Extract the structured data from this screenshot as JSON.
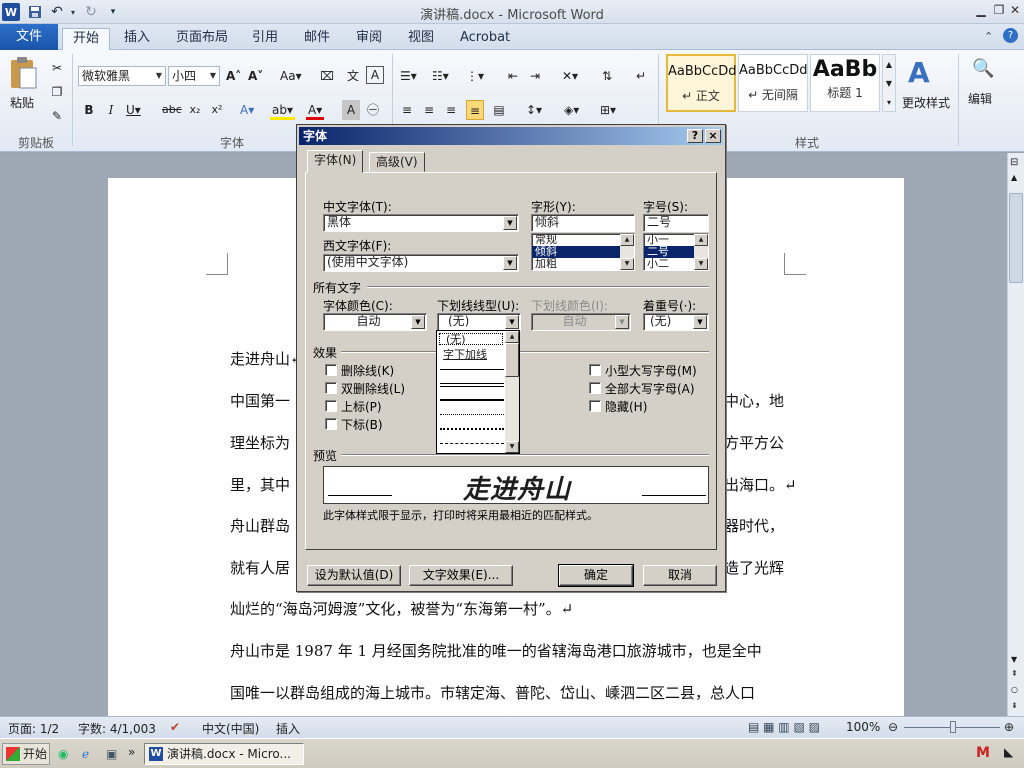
{
  "window": {
    "title": "演讲稿.docx - Microsoft Word",
    "undo_icon": "undo-icon",
    "redo_icon": "redo-icon"
  },
  "tabs": [
    "文件",
    "开始",
    "插入",
    "页面布局",
    "引用",
    "邮件",
    "审阅",
    "视图",
    "Acrobat"
  ],
  "ribbon": {
    "clipboard": {
      "paste": "粘贴",
      "group": "剪贴板"
    },
    "font": {
      "name": "微软雅黑",
      "size": "小四",
      "group": "字体"
    },
    "paragraph": {
      "group": "段落"
    },
    "styles": {
      "group": "样式",
      "items": [
        {
          "preview": "AaBbCcDd",
          "name": "↵ 正文"
        },
        {
          "preview": "AaBbCcDd",
          "name": "↵ 无间隔"
        },
        {
          "preview": "AaBb",
          "name": "标题 1"
        }
      ],
      "change": "更改样式"
    },
    "editing": {
      "label": "编辑"
    }
  },
  "document": {
    "lines": [
      "走进舟山↵",
      "中国第一",
      "理坐标为",
      "里，其中",
      "舟山群岛",
      "就有人居",
      "灿烂的“海岛河姆渡”文化，被誉为“东海第一村”。↵",
      "舟山市是 1987 年 1 月经国务院批准的唯一的省辖海岛港口旅游城市，也是全中",
      "国唯一以群岛组成的海上城市。市辖定海、普陀、岱山、嵊泗二区二县，总人口"
    ],
    "right_frags": [
      "中心，地",
      "方平方公",
      "出海口。↵",
      "器时代，",
      "造了光辉"
    ]
  },
  "dialog": {
    "title": "字体",
    "help": "?",
    "close": "×",
    "tabs": [
      "字体(N)",
      "高级(V)"
    ],
    "cn_font_label": "中文字体(T):",
    "cn_font_value": "黑体",
    "west_font_label": "西文字体(F):",
    "west_font_value": "(使用中文字体)",
    "style_label": "字形(Y):",
    "style_value": "倾斜",
    "style_options": [
      "常规",
      "倾斜",
      "加粗"
    ],
    "size_label": "字号(S):",
    "size_value": "二号",
    "size_options": [
      "小一",
      "二号",
      "小二"
    ],
    "all_text": "所有文字",
    "color_label": "字体颜色(C):",
    "color_value": "自动",
    "underline_label": "下划线线型(U):",
    "underline_value": "(无)",
    "underline_color_label": "下划线颜色(I):",
    "underline_color_value": "自动",
    "emphasis_label": "着重号(·):",
    "emphasis_value": "(无)",
    "underline_options": [
      "(无)",
      "字下加线"
    ],
    "effects": "效果",
    "effects_left": [
      "删除线(K)",
      "双删除线(L)",
      "上标(P)",
      "下标(B)"
    ],
    "effects_right": [
      "小型大写字母(M)",
      "全部大写字母(A)",
      "隐藏(H)"
    ],
    "preview_label": "预览",
    "preview_text": "走进舟山",
    "preview_note": "此字体样式限于显示，打印时将采用最相近的匹配样式。",
    "btn_default": "设为默认值(D)",
    "btn_effects": "文字效果(E)...",
    "btn_ok": "确定",
    "btn_cancel": "取消"
  },
  "status": {
    "page": "页面: 1/2",
    "words": "字数: 4/1,003",
    "lang": "中文(中国)",
    "mode": "插入",
    "zoom": "100%"
  },
  "taskbar": {
    "start": "开始",
    "task": "演讲稿.docx - Micro..."
  },
  "colors": {
    "accent": "#1a55a8",
    "dialog_title": "#0a246a"
  }
}
